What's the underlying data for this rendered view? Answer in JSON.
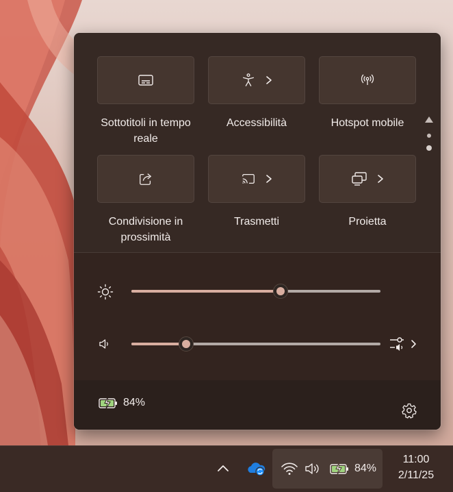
{
  "quick_settings": {
    "tiles": [
      {
        "label": "Sottotitoli in tempo reale",
        "icon": "captions-icon",
        "has_chevron": false,
        "active": false
      },
      {
        "label": "Accessibilità",
        "icon": "accessibility-icon",
        "has_chevron": true,
        "active": false
      },
      {
        "label": "Hotspot mobile",
        "icon": "hotspot-icon",
        "has_chevron": false,
        "active": false
      },
      {
        "label": "Condivisione in prossimità",
        "icon": "share-icon",
        "has_chevron": false,
        "active": false
      },
      {
        "label": "Trasmetti",
        "icon": "cast-icon",
        "has_chevron": true,
        "active": false
      },
      {
        "label": "Proietta",
        "icon": "project-icon",
        "has_chevron": true,
        "active": false
      }
    ],
    "pages": {
      "total": 3,
      "current": 2
    },
    "brightness": {
      "icon": "sun-icon",
      "value": 0.6
    },
    "volume": {
      "icon": "speaker-icon",
      "value": 0.22,
      "mixer_icon": "audio-mixer-icon"
    },
    "footer": {
      "battery_icon": "battery-charging-icon",
      "battery_text": "84%",
      "settings_icon": "gear-icon"
    }
  },
  "taskbar": {
    "tray_overflow_icon": "chevron-up-icon",
    "app_icon": "onedrive-sync-icon",
    "wifi_icon": "wifi-icon",
    "volume_icon": "speaker-icon",
    "battery_icon": "battery-charging-icon",
    "battery_text": "84%",
    "clock": {
      "time": "11:00",
      "date": "2/11/25"
    }
  },
  "colors": {
    "accent": "#d9aea0",
    "panel_bg": "#362924",
    "tile_bg": "#45362f",
    "battery_green": "#9fd37e"
  }
}
